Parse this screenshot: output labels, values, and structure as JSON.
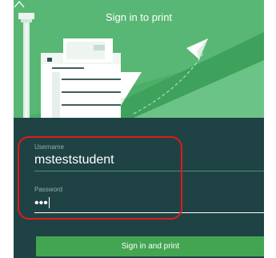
{
  "header": {
    "title": "Sign in to print",
    "collapse_icon": "chevron-up-icon"
  },
  "form": {
    "username": {
      "label": "Username",
      "value": "msteststudent"
    },
    "password": {
      "label": "Password",
      "value": "•••"
    }
  },
  "actions": {
    "submit_label": "Sign in and print"
  },
  "colors": {
    "panel_background": "#1f4345",
    "hero_background": "#4cae67",
    "accent_green": "#43a552",
    "highlight_red": "#e21a1a"
  }
}
